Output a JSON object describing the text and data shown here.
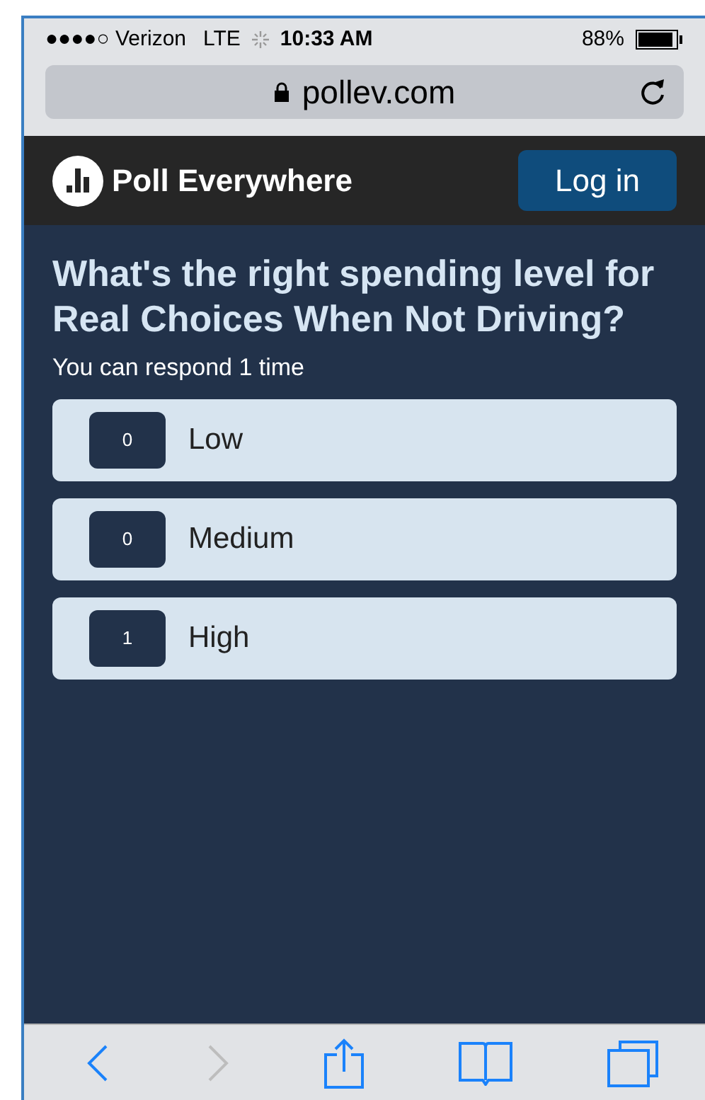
{
  "status_bar": {
    "carrier": "●●●●○ Verizon",
    "network": "LTE",
    "time": "10:33 AM",
    "battery": "88%"
  },
  "address_bar": {
    "url": "pollev.com"
  },
  "header": {
    "brand": "Poll Everywhere",
    "login_button": "Log in"
  },
  "poll": {
    "question": "What's the right spending level for Real Choices When Not Driving?",
    "note": "You can respond 1 time",
    "options": [
      {
        "count": "0",
        "label": "Low"
      },
      {
        "count": "0",
        "label": "Medium"
      },
      {
        "count": "1",
        "label": "High"
      }
    ]
  },
  "toolbar": [
    {
      "kind": "back",
      "disabled": false
    },
    {
      "kind": "forward",
      "disabled": true
    },
    {
      "kind": "share",
      "disabled": false
    },
    {
      "kind": "bookmarks",
      "disabled": false
    },
    {
      "kind": "tabs",
      "disabled": false
    }
  ]
}
